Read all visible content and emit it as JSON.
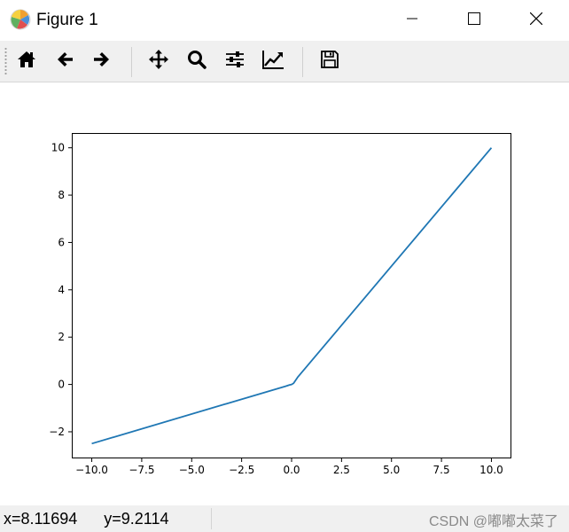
{
  "window": {
    "title": "Figure 1",
    "icons": {
      "app": "matplotlib-logo-icon",
      "minimize": "minimize-icon",
      "maximize": "maximize-icon",
      "close": "close-icon"
    }
  },
  "toolbar": {
    "buttons": [
      {
        "name": "home",
        "icon": "home-icon"
      },
      {
        "name": "back",
        "icon": "arrow-left-icon"
      },
      {
        "name": "forward",
        "icon": "arrow-right-icon"
      },
      {
        "name": "pan",
        "icon": "move-icon"
      },
      {
        "name": "zoom",
        "icon": "search-icon"
      },
      {
        "name": "configure-subplots",
        "icon": "sliders-icon"
      },
      {
        "name": "edit-axes",
        "icon": "line-chart-icon"
      },
      {
        "name": "save",
        "icon": "floppy-disk-icon"
      }
    ]
  },
  "chart_data": {
    "type": "line",
    "title": "",
    "xlabel": "",
    "ylabel": "",
    "xlim": [
      -11.0,
      11.0
    ],
    "ylim": [
      -3.125,
      10.625
    ],
    "xticks": [
      -10,
      -7.5,
      -5,
      -2.5,
      0,
      2.5,
      5,
      7.5,
      10
    ],
    "xtick_labels": [
      "−10.0",
      "−7.5",
      "−5.0",
      "−2.5",
      "0.0",
      "2.5",
      "5.0",
      "7.5",
      "10.0"
    ],
    "yticks": [
      -2,
      0,
      2,
      4,
      6,
      8,
      10
    ],
    "ytick_labels": [
      "−2",
      "0",
      "2",
      "4",
      "6",
      "8",
      "10"
    ],
    "grid": false,
    "series": [
      {
        "color": "#1f77b4",
        "x": [
          -10,
          -0.3,
          -0.1,
          0,
          0.1,
          0.3,
          10
        ],
        "y": [
          -2.5,
          -0.075,
          -0.02,
          0,
          0.05,
          0.3,
          10
        ]
      }
    ]
  },
  "status": {
    "coords": "x=8.11694      y=9.2114",
    "watermark": "CSDN @嘟嘟太菜了"
  }
}
